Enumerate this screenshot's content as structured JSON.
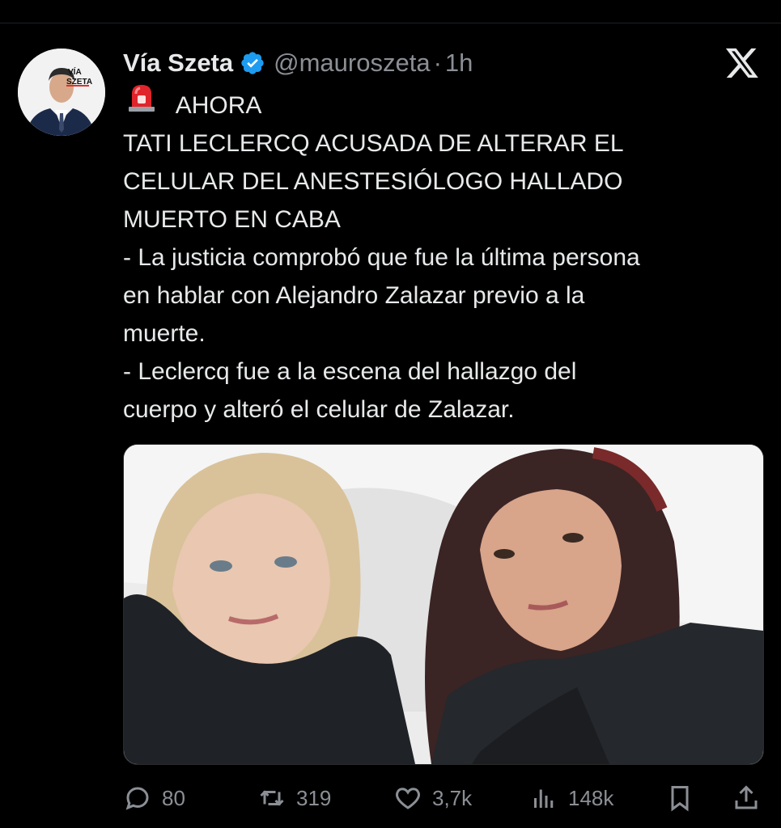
{
  "tweet": {
    "author_name": "Vía Szeta",
    "handle": "@mauroszeta",
    "separator": "·",
    "time": "1h",
    "avatar_text_line1": "VÍA",
    "avatar_text_line2": "SZETA",
    "verified_icon": "verified-badge-icon",
    "lines": {
      "l1": "AHORA",
      "l2": "TATI LECLERCQ ACUSADA DE ALTERAR EL",
      "l3": "CELULAR DEL ANESTESIÓLOGO HALLADO",
      "l4": "MUERTO EN CABA",
      "l5": "- La justicia comprobó que fue la última persona",
      "l6": "en hablar con Alejandro Zalazar previo a la",
      "l7": "muerte.",
      "l8": "- Leclercq fue a la escena del hallazgo del",
      "l9": "cuerpo y alteró el celular de Zalazar."
    },
    "image_desc_icon": "photo"
  },
  "actions": {
    "replies": "80",
    "retweets": "319",
    "likes": "3,7k",
    "views": "148k"
  },
  "colors": {
    "background": "#000000",
    "text": "#e7e9ea",
    "muted": "#8b8f95",
    "verified": "#1d9bf0"
  }
}
